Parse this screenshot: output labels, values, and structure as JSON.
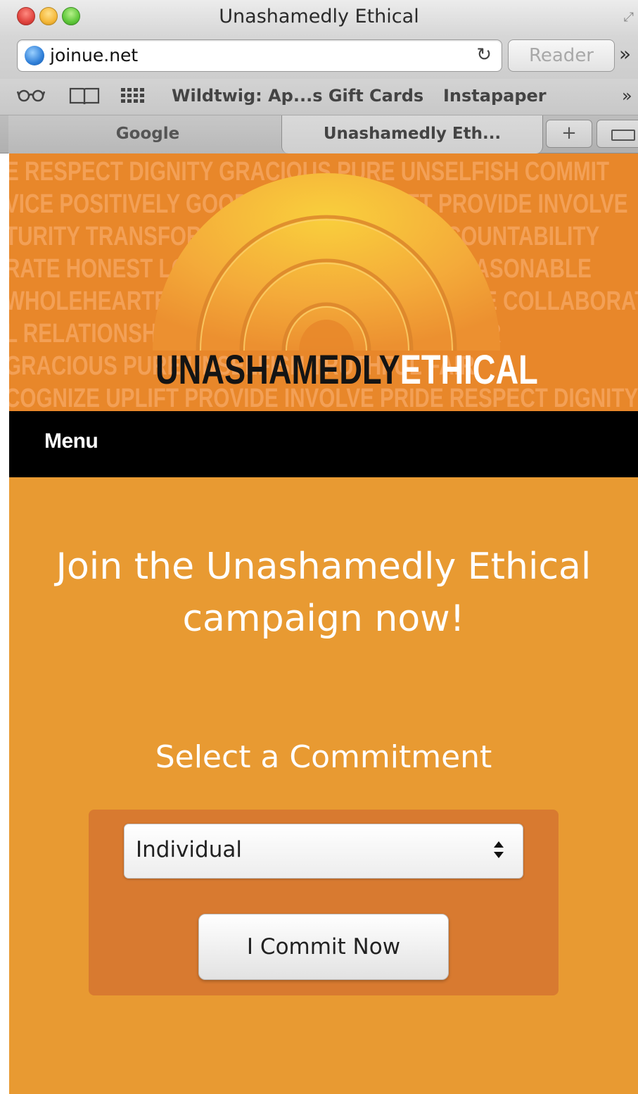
{
  "window": {
    "title": "Unashamedly Ethical",
    "traffic_lights": [
      "close-icon",
      "minimize-icon",
      "zoom-icon"
    ],
    "fullscreen_icon": "fullscreen-icon"
  },
  "toolbar": {
    "url": "joinue.net",
    "reader_label": "Reader",
    "overflow": "»"
  },
  "bookmarks": {
    "reading_list_icon": "glasses-icon",
    "bookmarks_icon": "book-icon",
    "top_sites_icon": "grid-icon",
    "items": [
      "Wildtwig: Ap...s Gift Cards",
      "Instapaper"
    ],
    "overflow": "»"
  },
  "tabs": {
    "items": [
      {
        "label": "Google",
        "active": false
      },
      {
        "label": "Unashamedly Eth...",
        "active": true
      }
    ],
    "new_tab_label": "+"
  },
  "banner": {
    "word_lines": [
      "E RESPECT DIGNITY GRACIOUS PURE UNSELFISH COMMIT",
      "VICE POSITIVELY GOOD RESPECT UPLIFT PROVIDE INVOLVE",
      "TURITY TRANSFORM INTEGRITY TRUST ACCOUNTABILITY",
      "RATE HONEST LOYAL FAIR PURE CLARITY REASONABLE",
      "WHOLEHEARTED COURAGE HONOR SACRIFICE COLLABORATE",
      "L RELATIONSHIPS DILIGENT FAIR PEACEMAKER",
      "GRACIOUS PURE UNSELFISH TRUTHFUL FAIR",
      "COGNIZE UPLIFT PROVIDE INVOLVE PRIDE RESPECT DIGNITY"
    ],
    "logo_dark": "UNASHAMEDLY",
    "logo_light": "ETHICAL",
    "colors": {
      "background": "#e8872a",
      "word_text": "#f3a056",
      "arch": "#f5b13a"
    }
  },
  "nav": {
    "menu_label": "Menu"
  },
  "main": {
    "headline": "Join the Unashamedly Ethical campaign now!",
    "subhead": "Select a Commitment",
    "select_value": "Individual",
    "commit_button_label": "I Commit Now",
    "colors": {
      "background": "#e89a32",
      "panel": "#d87a30"
    }
  }
}
